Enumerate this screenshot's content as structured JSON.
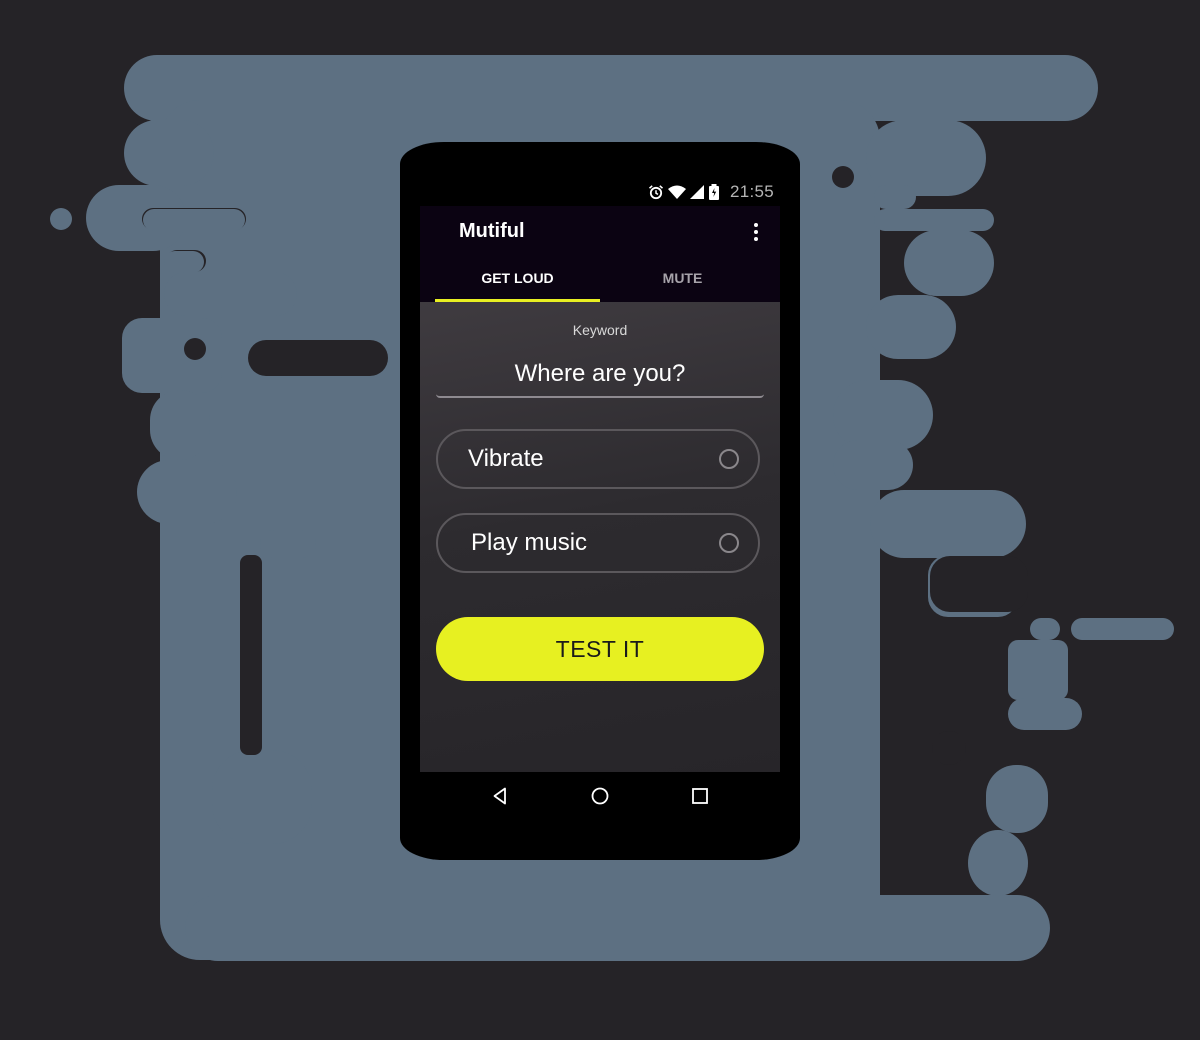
{
  "status_bar": {
    "time": "21:55",
    "icons": [
      "alarm-icon",
      "wifi-icon",
      "signal-icon",
      "battery-icon"
    ]
  },
  "app_bar": {
    "title": "Mutiful",
    "menu_icon": "overflow-menu-icon"
  },
  "tabs": [
    {
      "label": "GET LOUD",
      "active": true
    },
    {
      "label": "MUTE",
      "active": false
    }
  ],
  "form": {
    "keyword_label": "Keyword",
    "keyword_value": "Where are you?",
    "options": [
      {
        "label": "Vibrate",
        "selected": false
      },
      {
        "label": "Play music",
        "selected": false
      }
    ],
    "test_button_label": "TEST IT"
  },
  "nav_bar": {
    "icons": [
      "back-icon",
      "home-icon",
      "recents-icon"
    ]
  },
  "colors": {
    "accent": "#e7f021",
    "app_bar_bg": "#0b0312",
    "page_bg": "#252327",
    "blob": "#5d7082"
  }
}
